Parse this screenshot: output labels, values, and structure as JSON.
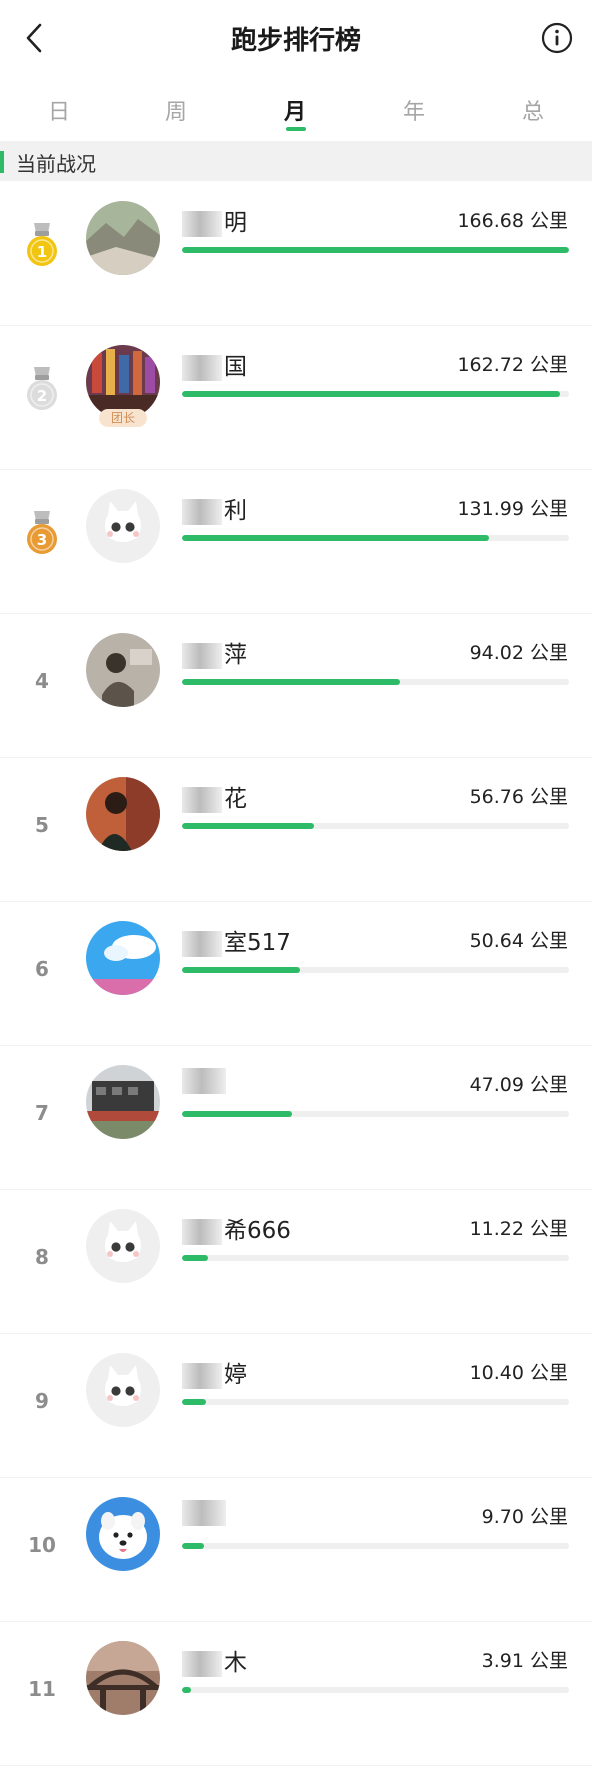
{
  "header": {
    "title": "跑步排行榜"
  },
  "tabs": [
    {
      "label": "日",
      "active": false
    },
    {
      "label": "周",
      "active": false
    },
    {
      "label": "月",
      "active": true
    },
    {
      "label": "年",
      "active": false
    },
    {
      "label": "总",
      "active": false
    }
  ],
  "section": {
    "title": "当前战况"
  },
  "colors": {
    "accent": "#2dbb67",
    "track": "#efefef",
    "gold": "#f2c511",
    "silver": "#dcdcdc",
    "bronze": "#e89a33"
  },
  "rankings": [
    {
      "rank": "1",
      "medal": "gold",
      "name": "明",
      "distance": "166.68 公里",
      "progress": 1.0,
      "avatar": "landscape"
    },
    {
      "rank": "2",
      "medal": "silver",
      "name": "国",
      "distance": "162.72 公里",
      "progress": 0.976,
      "avatar": "market",
      "badge": "团长"
    },
    {
      "rank": "3",
      "medal": "bronze",
      "name": "利",
      "distance": "131.99 公里",
      "progress": 0.792,
      "avatar": "default"
    },
    {
      "rank": "4",
      "medal": null,
      "name": "萍",
      "distance": "94.02 公里",
      "progress": 0.564,
      "avatar": "portrait-gray"
    },
    {
      "rank": "5",
      "medal": null,
      "name": "花",
      "distance": "56.76 公里",
      "progress": 0.341,
      "avatar": "portrait-dark"
    },
    {
      "rank": "6",
      "medal": null,
      "name": "室517",
      "distance": "50.64 公里",
      "progress": 0.304,
      "avatar": "sky"
    },
    {
      "rank": "7",
      "medal": null,
      "name": "",
      "distance": "47.09 公里",
      "progress": 0.283,
      "avatar": "building"
    },
    {
      "rank": "8",
      "medal": null,
      "name": "希666",
      "distance": "11.22 公里",
      "progress": 0.067,
      "avatar": "default"
    },
    {
      "rank": "9",
      "medal": null,
      "name": "婷",
      "distance": "10.40 公里",
      "progress": 0.062,
      "avatar": "default"
    },
    {
      "rank": "10",
      "medal": null,
      "name": "",
      "distance": "9.70 公里",
      "progress": 0.058,
      "avatar": "dog"
    },
    {
      "rank": "11",
      "medal": null,
      "name": "木",
      "distance": "3.91 公里",
      "progress": 0.023,
      "avatar": "bridge"
    }
  ]
}
